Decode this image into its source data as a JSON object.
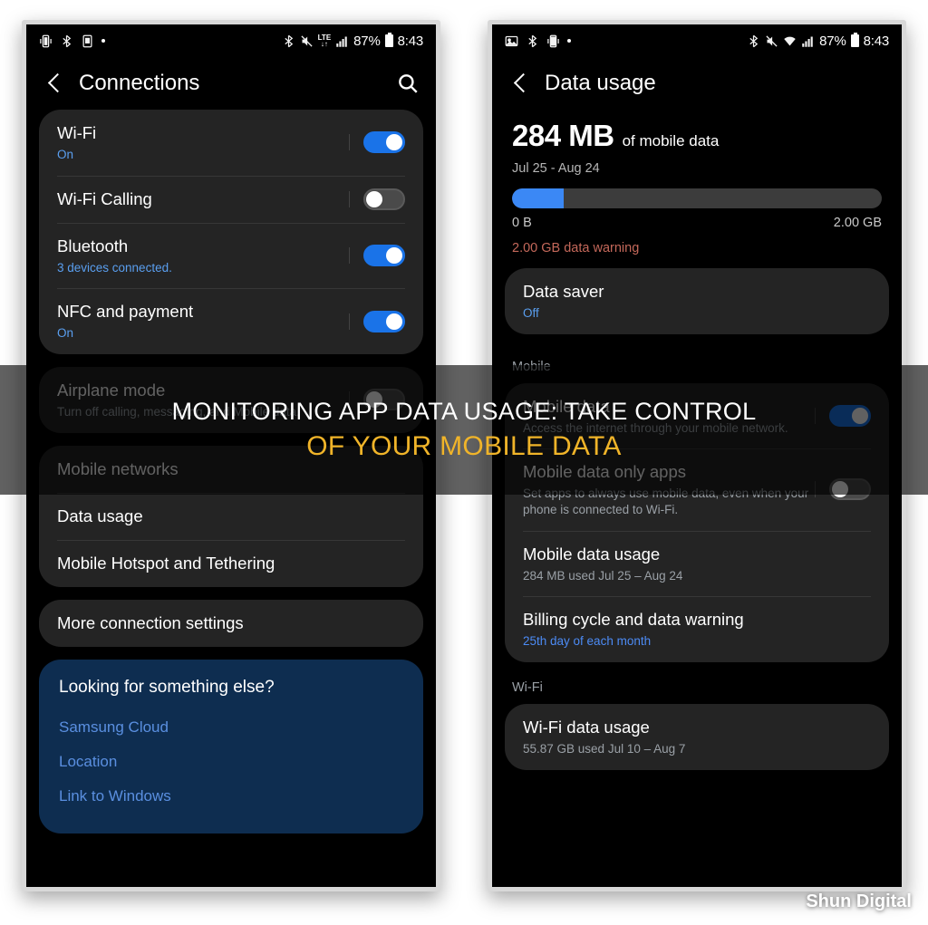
{
  "background": "#ffffff",
  "accent_blue": "#1a73e8",
  "warning_color": "#c4685a",
  "overlay": {
    "line1": "MONITORING APP DATA USAGE: TAKE CONTROL",
    "line2": "OF YOUR MOBILE DATA"
  },
  "watermark": "Shun Digital",
  "left_phone": {
    "status_bar": {
      "icons": [
        "vibrate-icon",
        "bluetooth-share-icon",
        "sim-icon",
        "dot-icon"
      ],
      "right_icons": [
        "bluetooth-icon",
        "mute-icon",
        "lte-icon",
        "signal-icon"
      ],
      "lte_label": "LTE",
      "battery": "87%",
      "time": "8:43"
    },
    "appbar": {
      "back": "back-chevron",
      "title": "Connections",
      "search": "search-icon"
    },
    "card1": [
      {
        "title": "Wi-Fi",
        "sub": "On",
        "sub_style": "blue",
        "toggle": "on"
      },
      {
        "title": "Wi-Fi Calling",
        "sub": "",
        "toggle": "off"
      },
      {
        "title": "Bluetooth",
        "sub": "3 devices connected.",
        "sub_style": "blue",
        "toggle": "on"
      },
      {
        "title": "NFC and payment",
        "sub": "On",
        "sub_style": "blue",
        "toggle": "on"
      }
    ],
    "card2": [
      {
        "title": "Airplane mode",
        "sub": "Turn off calling, messaging, and Mobile data.",
        "toggle": "off"
      }
    ],
    "card3": [
      {
        "title": "Mobile networks",
        "sub": ""
      },
      {
        "title": "Data usage",
        "sub": ""
      },
      {
        "title": "Mobile Hotspot and Tethering",
        "sub": ""
      }
    ],
    "card4": [
      {
        "title": "More connection settings",
        "sub": ""
      }
    ],
    "promo": {
      "title": "Looking for something else?",
      "links": [
        "Samsung Cloud",
        "Location",
        "Link to Windows"
      ]
    }
  },
  "right_phone": {
    "status_bar": {
      "icons": [
        "image-icon",
        "bluetooth-share-icon",
        "vibrate-icon",
        "dot-icon"
      ],
      "right_icons": [
        "bluetooth-icon",
        "mute-icon",
        "wifi-icon",
        "signal-icon"
      ],
      "battery": "87%",
      "time": "8:43"
    },
    "appbar": {
      "back": "back-chevron",
      "title": "Data usage"
    },
    "summary": {
      "amount": "284 MB",
      "amount_suffix": "of mobile data",
      "date_range": "Jul 25 - Aug 24",
      "bar_min": "0 B",
      "bar_max": "2.00 GB",
      "bar_percent": 13.9,
      "warning": "2.00 GB data warning"
    },
    "card_datasaver": [
      {
        "title": "Data saver",
        "sub": "Off",
        "sub_style": "blue"
      }
    ],
    "section_mobile": "Mobile",
    "card_mobile": [
      {
        "title": "Mobile data",
        "sub": "Access the internet through your mobile network.",
        "toggle": "on"
      },
      {
        "title": "Mobile data only apps",
        "sub": "Set apps to always use mobile data, even when your phone is connected to Wi-Fi.",
        "toggle": "off"
      },
      {
        "title": "Mobile data usage",
        "sub": "284 MB used Jul 25 – Aug 24"
      },
      {
        "title": "Billing cycle and data warning",
        "sub": "25th day of each month",
        "sub_style": "link"
      }
    ],
    "section_wifi": "Wi-Fi",
    "card_wifi": [
      {
        "title": "Wi-Fi data usage",
        "sub": "55.87 GB used Jul 10 – Aug 7"
      }
    ]
  }
}
